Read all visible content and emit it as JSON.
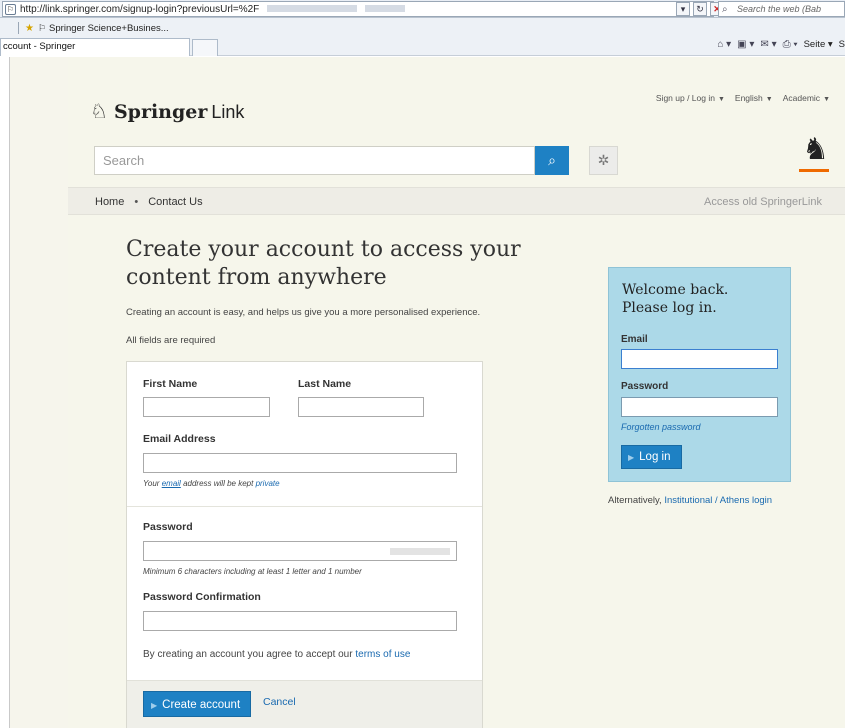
{
  "browser": {
    "url": "http://link.springer.com/signup-login?previousUrl=%2F",
    "web_search_placeholder": "Search the web (Bab",
    "favorites_item": "Springer Science+Busines...",
    "tab_title": "ccount - Springer",
    "cmd_page_label": "Seite",
    "cmd_overflow": "S"
  },
  "header": {
    "top_links": {
      "signup_login": "Sign up / Log in",
      "language": "English",
      "audience": "Academic"
    },
    "logo_main": "Springer",
    "logo_sub": "Link",
    "search_placeholder": "Search",
    "search_icon": "search-icon",
    "gear_icon": "gear-icon",
    "brand_color": "#ef6a00",
    "accent_color": "#1e81c4"
  },
  "nav": {
    "home": "Home",
    "separator": "•",
    "contact": "Contact Us",
    "old_link": "Access old SpringerLink"
  },
  "signup": {
    "heading": "Create your account to access your content from anywhere",
    "intro": "Creating an account is easy, and helps us give you a more personalised experience.",
    "required_note": "All fields are required",
    "first_name_label": "First Name",
    "last_name_label": "Last Name",
    "email_label": "Email Address",
    "email_hint_pre": "Your",
    "email_hint_link": "email",
    "email_hint_mid": "address will be kept",
    "email_hint_link2": "private",
    "password_label": "Password",
    "password_hint": "Minimum 6 characters including at least 1 letter and 1 number",
    "password_confirm_label": "Password Confirmation",
    "agree_text": "By creating an account you agree to accept our",
    "agree_link": "terms of use",
    "create_button": "Create account",
    "cancel_link": "Cancel"
  },
  "login": {
    "title_line1": "Welcome back.",
    "title_line2": "Please log in.",
    "email_label": "Email",
    "password_label": "Password",
    "forgot_link": "Forgotten password",
    "login_button": "Log in",
    "panel_color": "#acd9e8",
    "alt_text": "Alternatively,",
    "alt_link": "Institutional / Athens login"
  }
}
